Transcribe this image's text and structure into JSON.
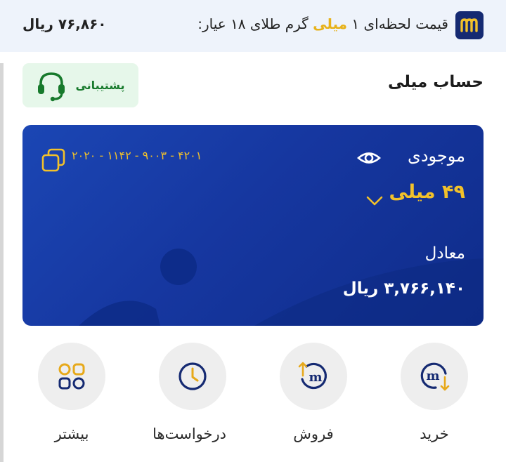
{
  "price_bar": {
    "title_part1": "قیمت لحظه‌ای ۱",
    "title_highlight": "میلی",
    "title_part2": "گرم طلای ۱۸ عیار:",
    "value": "۷۶,۸۶۰ ریال",
    "logo_letter": "m"
  },
  "header": {
    "title": "حساب میلی",
    "support_label": "پشتیبانی"
  },
  "card": {
    "balance_label": "موجودی",
    "balance_value": "۴۹ میلی",
    "account_number": "۴۲۰۱ - ۹۰۰۳ - ۱۱۴۲ - ۲۰۲۰",
    "equivalent_label": "معادل",
    "equivalent_value": "۳,۷۶۶,۱۴۰ ریال"
  },
  "actions": [
    {
      "label": "خرید",
      "icon": "buy-icon"
    },
    {
      "label": "فروش",
      "icon": "sell-icon"
    },
    {
      "label": "درخواست‌ها",
      "icon": "clock-icon"
    },
    {
      "label": "بیشتر",
      "icon": "grid-icon"
    }
  ],
  "colors": {
    "brand_navy": "#152a72",
    "gold": "#f2c12a",
    "support_green": "#177a2c",
    "card_blue": "#1637a0"
  }
}
